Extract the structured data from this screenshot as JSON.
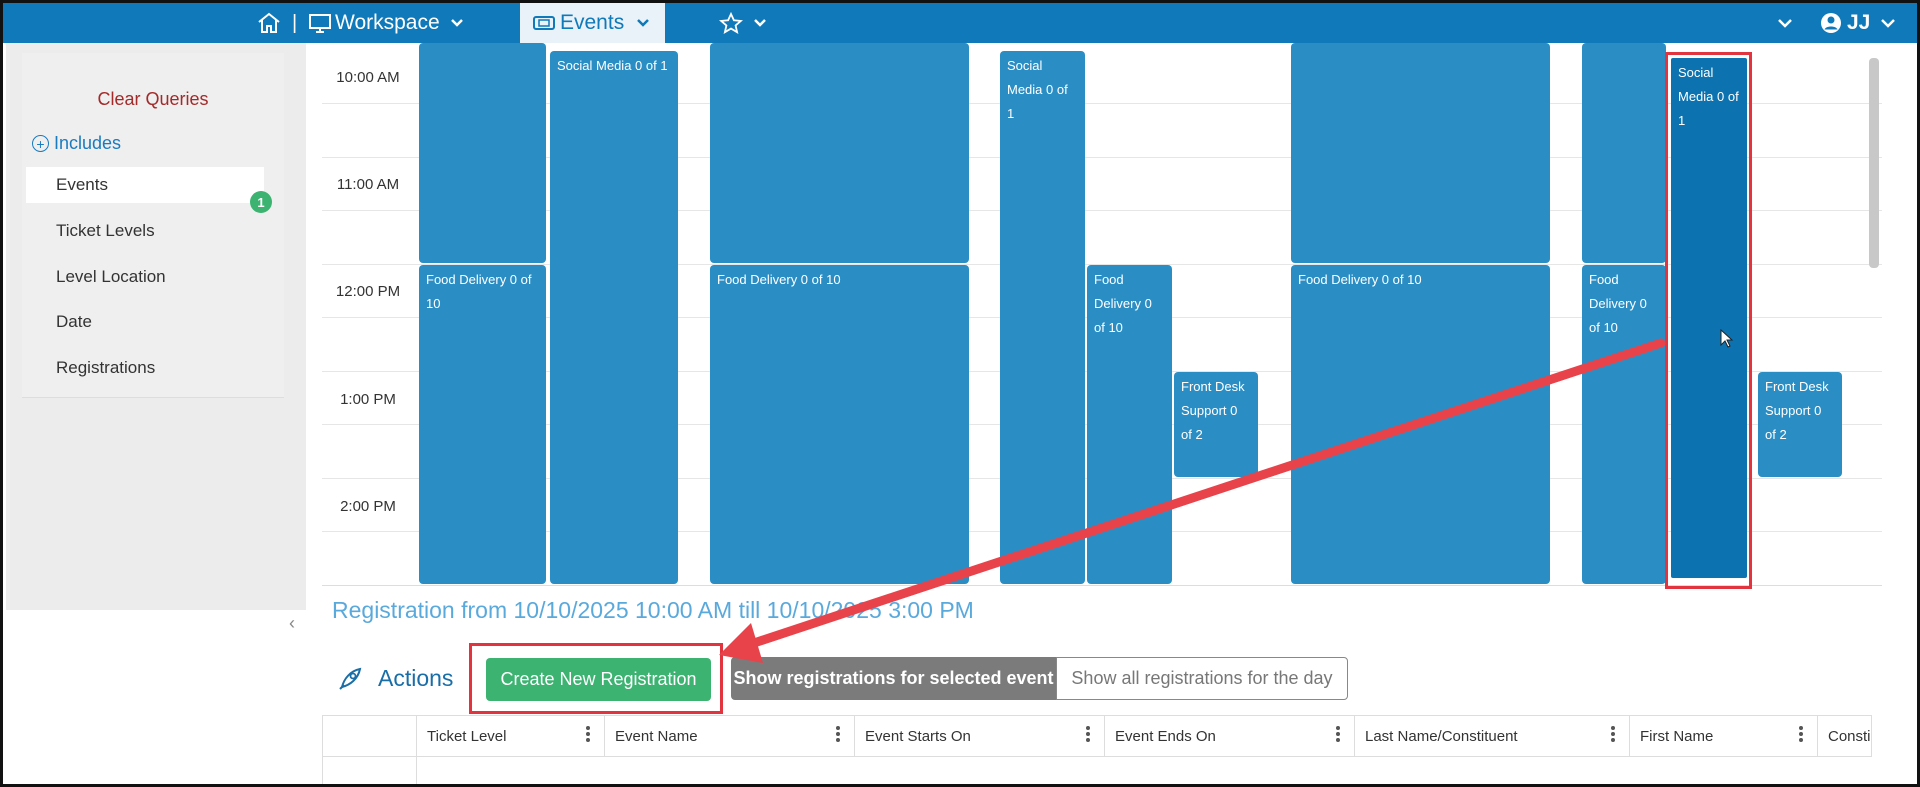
{
  "topnav": {
    "separator": "|",
    "workspace_label": "Workspace",
    "events_label": "Events",
    "user_initials": "JJ",
    "bg_color": "#0f79b9"
  },
  "sidebar": {
    "clear_queries": "Clear Queries",
    "includes_label": "Includes",
    "includes_count": "1",
    "items": [
      {
        "label": "Events",
        "active": true
      },
      {
        "label": "Ticket Levels",
        "active": false
      },
      {
        "label": "Level Location",
        "active": false
      },
      {
        "label": "Date",
        "active": false
      },
      {
        "label": "Registrations",
        "active": false
      }
    ],
    "collapse_icon": "chevron-left-icon"
  },
  "calendar": {
    "time_labels": [
      "10:00 AM",
      "11:00 AM",
      "12:00 PM",
      "1:00 PM",
      "2:00 PM"
    ],
    "events": [
      {
        "text": ""
      },
      {
        "text": "Food Delivery 0 of 10"
      },
      {
        "text": "Social Media 0 of 1"
      },
      {
        "text": ""
      },
      {
        "text": "Food Delivery 0 of 10"
      },
      {
        "text": "Social Media 0 of 1"
      },
      {
        "text": "Food Delivery 0 of 10"
      },
      {
        "text": "Front Desk Support 0 of 2"
      },
      {
        "text": ""
      },
      {
        "text": "Food Delivery 0 of 10"
      },
      {
        "text": ""
      },
      {
        "text": "Food Delivery 0 of 10"
      },
      {
        "text": "Social Media 0 of 1",
        "selected": true
      },
      {
        "text": "Front Desk Support 0 of 2"
      }
    ],
    "event_color": "#2a8ec5",
    "selected_color": "#0c72b0",
    "highlight_color": "#e2343e"
  },
  "registration": {
    "title": "Registration from 10/10/2025 10:00 AM till 10/10/2025 3:00 PM",
    "actions_label": "Actions",
    "create_button": "Create New Registration",
    "show_selected": "Show registrations for selected event",
    "show_all": "Show all registrations for the day",
    "create_color": "#3cb371"
  },
  "table": {
    "columns": [
      "Ticket Level",
      "Event Name",
      "Event Starts On",
      "Event Ends On",
      "Last Name/Constituent",
      "First Name",
      "Consti"
    ]
  }
}
